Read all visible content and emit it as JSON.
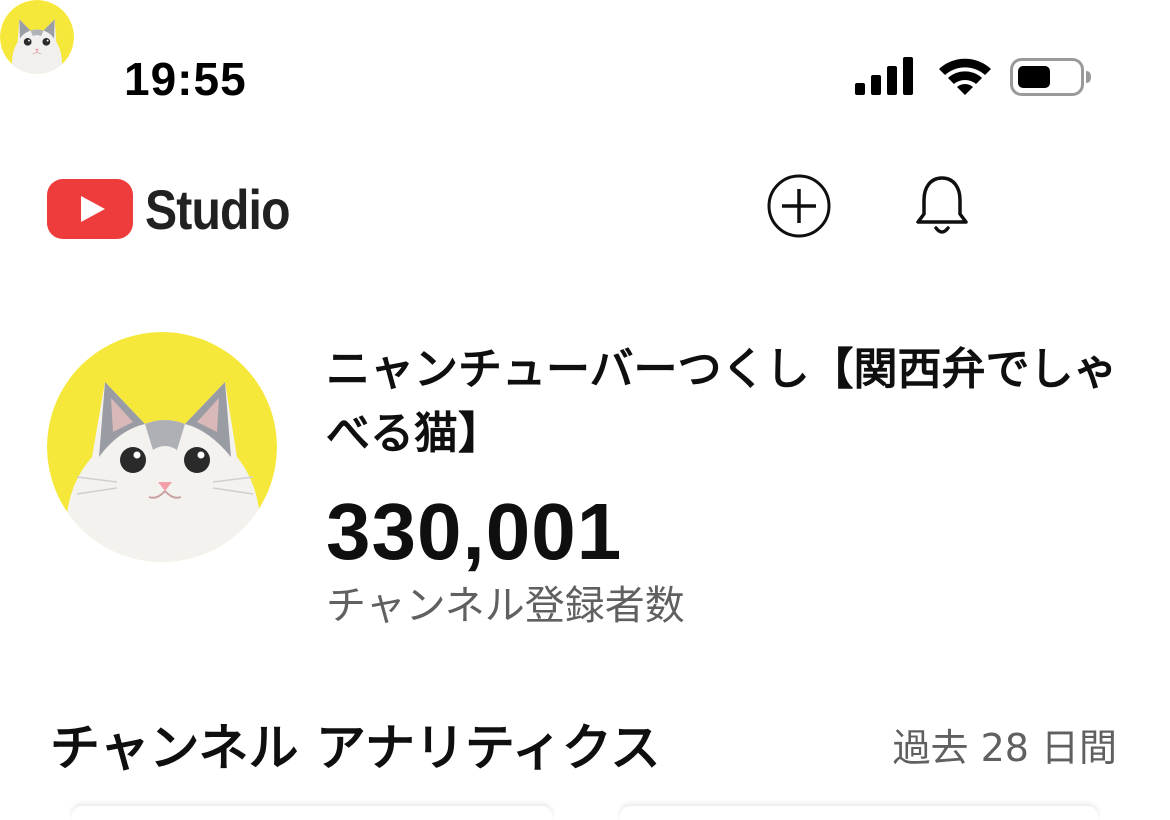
{
  "status_bar": {
    "time": "19:55",
    "icons": [
      "signal-icon",
      "wifi-icon",
      "battery-icon"
    ]
  },
  "header": {
    "logo_text": "Studio",
    "logo_icon": "youtube-play-icon",
    "actions": [
      "create-icon",
      "bell-icon",
      "avatar"
    ]
  },
  "channel": {
    "name": "ニャンチューバーつくし【関西弁でしゃべる猫】",
    "subscriber_count": "330,001",
    "subscriber_label": "チャンネル登録者数"
  },
  "analytics": {
    "title": "チャンネル アナリティクス",
    "period": "過去 28 日間"
  },
  "colors": {
    "youtube_red": "#ee3b3b",
    "avatar_bg": "#f5e83b",
    "secondary_text": "#606060"
  }
}
